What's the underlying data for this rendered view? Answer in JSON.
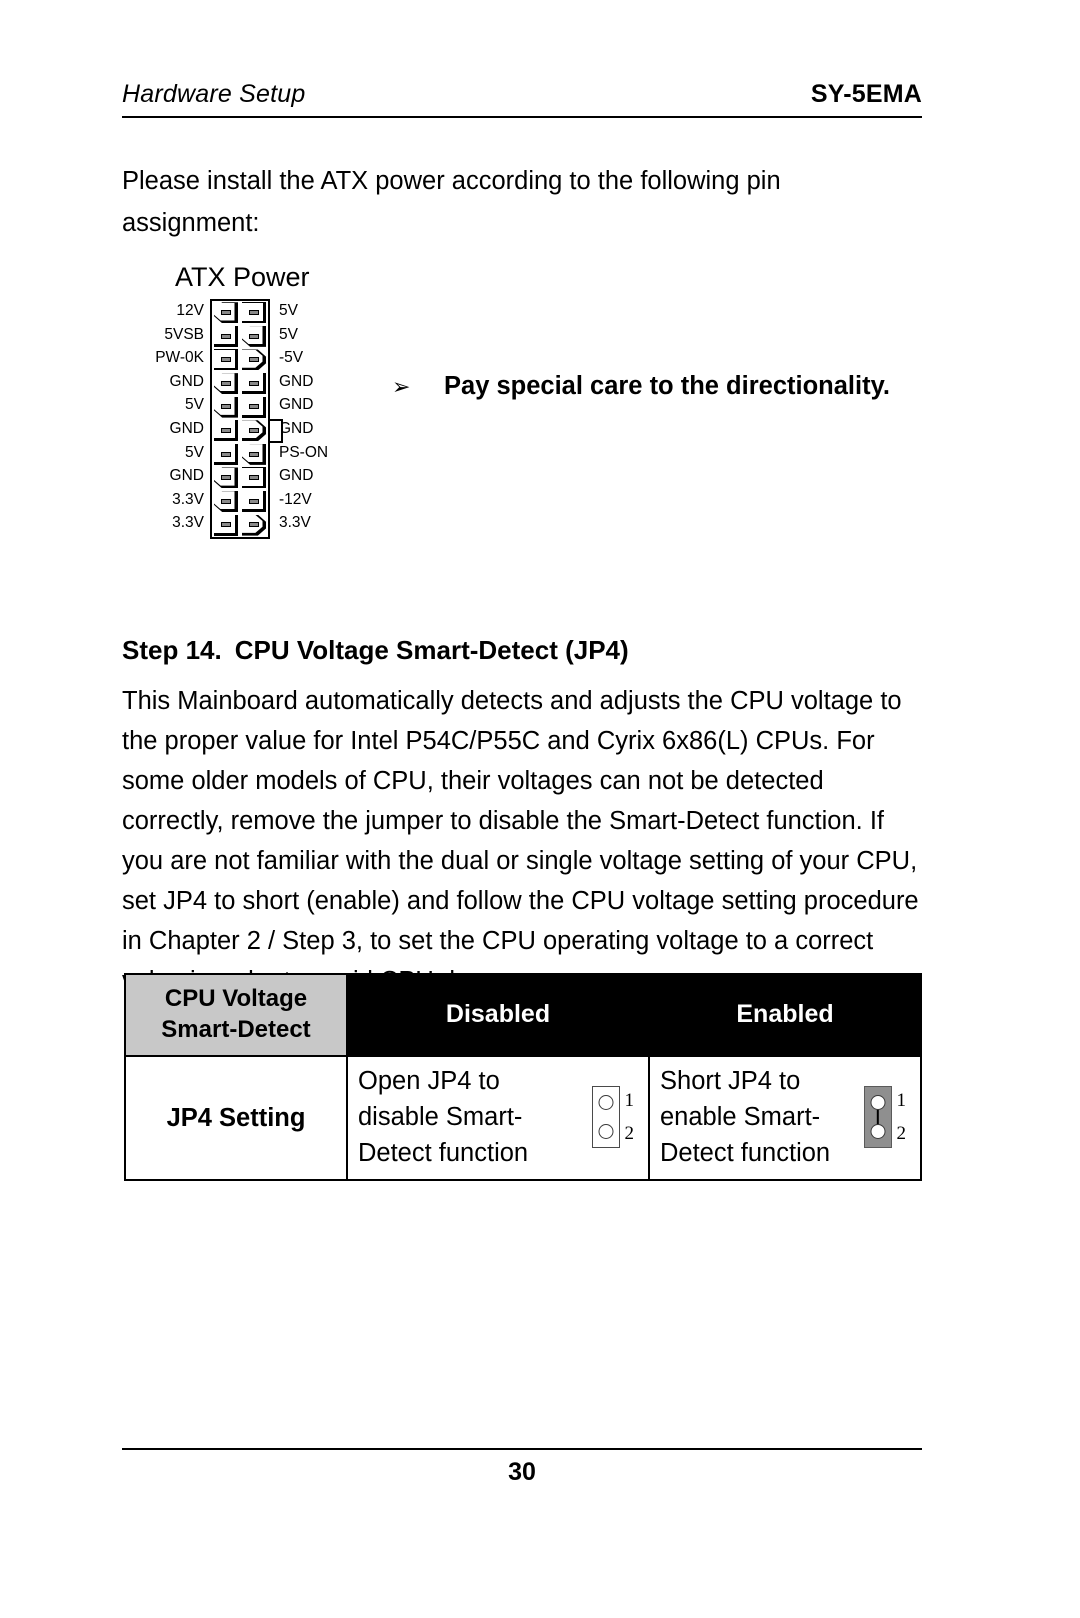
{
  "header": {
    "left_title": "Hardware Setup",
    "right_title": "SY-5EMA"
  },
  "intro": {
    "paragraph": "Please install the ATX power according to the following pin assignment:"
  },
  "atx_figure": {
    "title": "ATX Power",
    "left_labels": [
      "12V",
      "5VSB",
      "PW-0K",
      "GND",
      "5V",
      "GND",
      "5V",
      "GND",
      "3.3V",
      "3.3V"
    ],
    "right_labels": [
      "5V",
      "5V",
      "-5V",
      "GND",
      "GND",
      "GND",
      "PS-ON",
      "GND",
      "-12V",
      "3.3V"
    ],
    "latch_icon": "connector-latch-icon"
  },
  "note": {
    "bullet": "➢",
    "text": "Pay special care to the directionality."
  },
  "step": {
    "number": "Step 14.",
    "title": "CPU Voltage Smart-Detect (JP4)",
    "body": "This Mainboard automatically detects and adjusts the CPU voltage to the proper value for Intel P54C/P55C and Cyrix 6x86(L) CPUs. For some older models of CPU, their voltages can not be detected correctly, remove the jumper to disable the Smart-Detect function. If you are not familiar with the dual or single voltage setting of your CPU, set JP4 to short (enable) and follow the CPU voltage setting procedure in Chapter 2 / Step 3, to set the CPU operating voltage to a correct value in order to avoid CPU damage."
  },
  "jp4_table": {
    "header": {
      "label": "CPU Voltage Smart-Detect",
      "label_line1": "CPU Voltage",
      "label_line2": "Smart-Detect",
      "disabled": "Disabled",
      "enabled": "Enabled"
    },
    "row": {
      "label": "JP4 Setting",
      "disabled_text_line1": "Open JP4 to",
      "disabled_text_line2": "disable Smart-",
      "disabled_text_line3": "Detect function",
      "enabled_text_line1": "Short JP4 to",
      "enabled_text_line2": "enable Smart-",
      "enabled_text_line3": "Detect function",
      "disabled_jumper": {
        "icon": "jumper-open-icon",
        "pin1": "1",
        "pin2": "2",
        "state": "open"
      },
      "enabled_jumper": {
        "icon": "jumper-shorted-icon",
        "pin1": "1",
        "pin2": "2",
        "state": "shorted"
      }
    }
  },
  "footer": {
    "page_number": "30"
  },
  "colors": {
    "header_cell_gray": "#c8c8c8",
    "header_state_bg": "#000000",
    "header_state_fg": "#ffffff",
    "jumper_shorted_fill": "#8f8f8f",
    "rule": "#000000"
  }
}
